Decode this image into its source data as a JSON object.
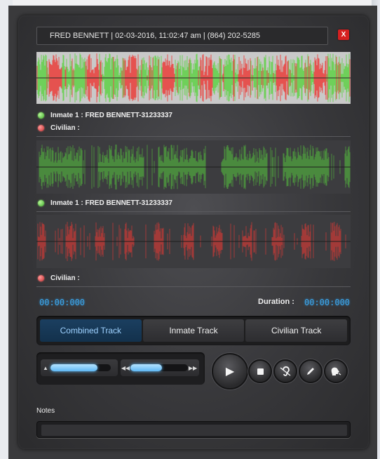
{
  "header": {
    "title": "FRED BENNETT | 02-03-2016, 11:02:47 am | (864) 202-5285",
    "close_label": "X"
  },
  "tracks": {
    "inmate_label": "Inmate 1 :  FRED BENNETT-31233337",
    "civilian_label": "Civilian :"
  },
  "player": {
    "current_time": "00:00:000",
    "duration_label": "Duration :",
    "duration": "00:00:000",
    "volume_level": 0.78,
    "speed_level": 0.55
  },
  "tabs": [
    {
      "label": "Combined Track",
      "active": true
    },
    {
      "label": "Inmate Track",
      "active": false
    },
    {
      "label": "Civilian Track",
      "active": false
    }
  ],
  "notes": {
    "label": "Notes",
    "value": ""
  },
  "colors": {
    "inmate": "#6fd05a",
    "civilian": "#e5524f",
    "accent": "#3aa8f0"
  },
  "icons": {
    "volume": "speaker-icon",
    "rewind": "rewind-icon",
    "forward": "fast-forward-icon",
    "play": "play-icon",
    "stop": "stop-icon",
    "listen": "ear-icon",
    "edit": "pencil-icon",
    "speaker": "speaking-head-icon"
  }
}
